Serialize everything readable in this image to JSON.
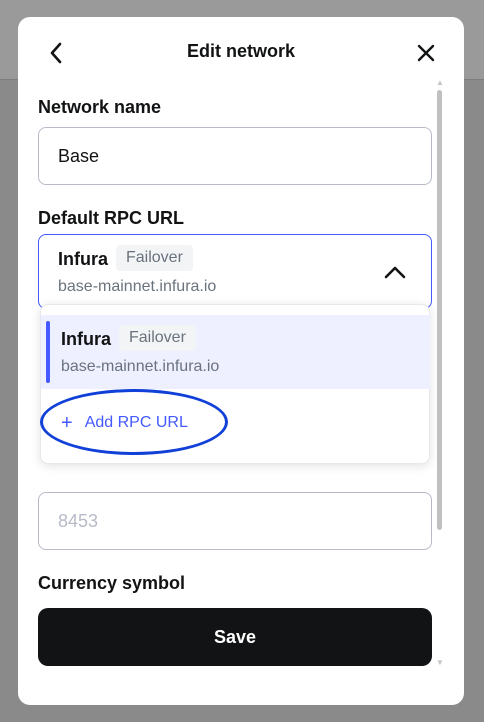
{
  "header": {
    "title": "Edit network"
  },
  "form": {
    "network_name_label": "Network name",
    "network_name_value": "Base",
    "rpc_label": "Default RPC URL",
    "rpc_selected_name": "Infura",
    "rpc_selected_badge": "Failover",
    "rpc_selected_url": "base-mainnet.infura.io",
    "chain_id_placeholder": "8453",
    "currency_label": "Currency symbol"
  },
  "dropdown": {
    "items": [
      {
        "name": "Infura",
        "badge": "Failover",
        "url": "base-mainnet.infura.io"
      }
    ],
    "add_label": "Add RPC URL",
    "add_icon": "+"
  },
  "footer": {
    "save_label": "Save"
  },
  "colors": {
    "accent": "#4459ff",
    "annotation": "#1040d8",
    "button_bg": "#121314",
    "selected_item_bg": "#eef0ff"
  },
  "icons": {
    "back": "arrow-left-icon",
    "close": "close-icon",
    "chevron": "chevron-up-icon",
    "add": "plus-icon"
  }
}
